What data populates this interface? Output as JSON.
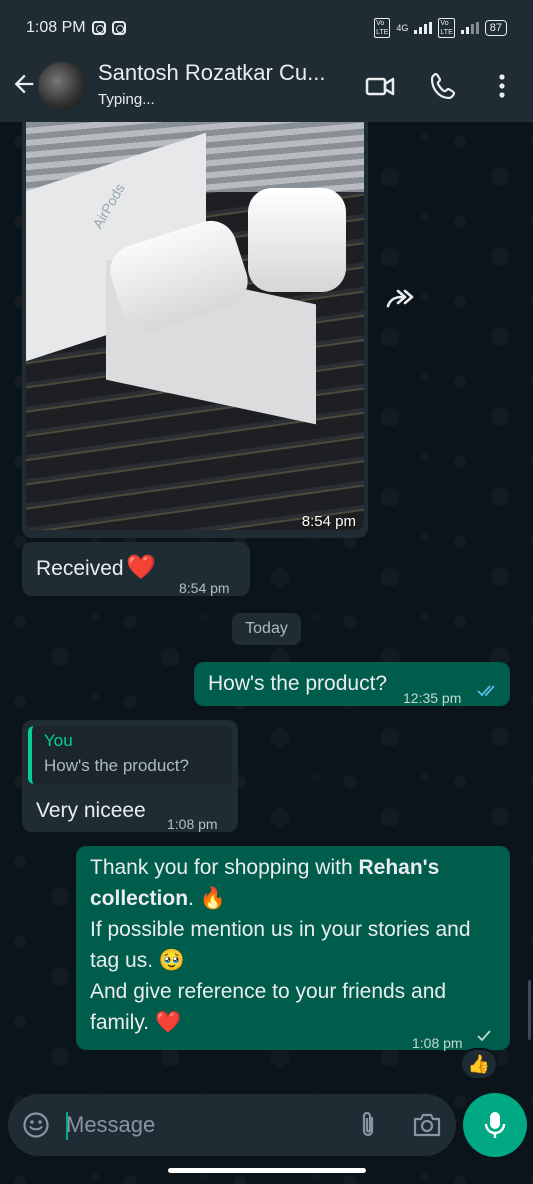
{
  "status_bar": {
    "time": "1:08 PM",
    "network_label": "4G",
    "battery": "87"
  },
  "header": {
    "contact_name": "Santosh Rozatkar Cu...",
    "contact_status": "Typing..."
  },
  "messages": [
    {
      "id": "media",
      "direction": "in",
      "type": "image",
      "time": "8:54 pm",
      "photo_text": "AirPods"
    },
    {
      "id": "received",
      "direction": "in",
      "text": "Received",
      "emoji": "❤️",
      "time": "8:54 pm"
    },
    {
      "id": "product_q",
      "direction": "out",
      "text": "How's the product?",
      "time": "12:35 pm",
      "ticks": "read"
    },
    {
      "id": "reply",
      "direction": "in",
      "quote_author": "You",
      "quote_text": "How's the product?",
      "text": "Very niceee",
      "time": "1:08 pm"
    },
    {
      "id": "thanks",
      "direction": "out",
      "time": "1:08 pm",
      "ticks": "sent",
      "line1_pre": "Thank you for shopping with ",
      "line1_bold": "Rehan's",
      "line2_bold": "collection",
      "line2_post": ". 🔥",
      "line3": "If possible mention us in your stories and",
      "line4": "tag us. 🥹",
      "line5": "And give reference to your friends and",
      "line6": "family. ❤️",
      "reaction": "👍"
    }
  ],
  "date_divider": "Today",
  "composer": {
    "placeholder": "Message"
  },
  "colors": {
    "background": "#0b141a",
    "bar": "#1f2c34",
    "outgoing": "#005c4b",
    "incoming": "#1f2c34",
    "accent": "#00a884",
    "read_tick": "#53bdeb"
  },
  "icons": [
    "back-arrow-icon",
    "video-call-icon",
    "voice-call-icon",
    "more-menu-icon",
    "forward-icon",
    "emoji-icon",
    "attach-icon",
    "camera-icon",
    "mic-icon",
    "double-check-icon",
    "single-check-icon"
  ]
}
